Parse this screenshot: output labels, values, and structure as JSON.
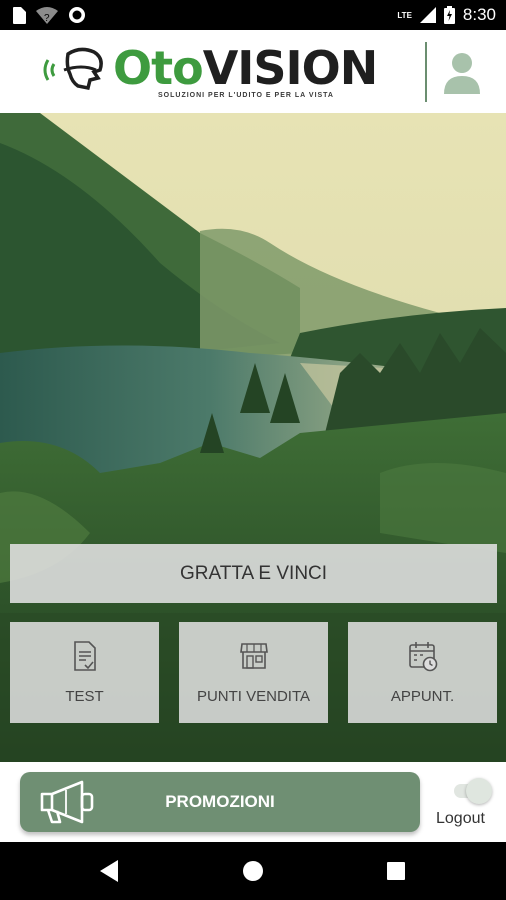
{
  "status_bar": {
    "time": "8:30",
    "network": "LTE",
    "icons": [
      "sim-card-icon",
      "wifi-question-icon",
      "circle-record-icon",
      "signal-icon",
      "battery-icon"
    ]
  },
  "header": {
    "brand_part1": "Oto",
    "brand_part2": "VISION",
    "tagline": "SOLUZIONI PER L'UDITO E PER LA VISTA",
    "brand_color": "#3e9b3f"
  },
  "main": {
    "gratta_label": "GRATTA E VINCI",
    "tiles": [
      {
        "label": "TEST",
        "icon": "document-check-icon"
      },
      {
        "label": "PUNTI VENDITA",
        "icon": "store-icon"
      },
      {
        "label": "APPUNT.",
        "icon": "calendar-clock-icon"
      }
    ]
  },
  "bottom": {
    "promo_label": "PROMOZIONI",
    "promo_icon": "megaphone-icon",
    "logout_label": "Logout",
    "accent": "#6f8f73"
  },
  "nav": {
    "icons": [
      "back-icon",
      "home-icon",
      "recents-icon"
    ]
  }
}
